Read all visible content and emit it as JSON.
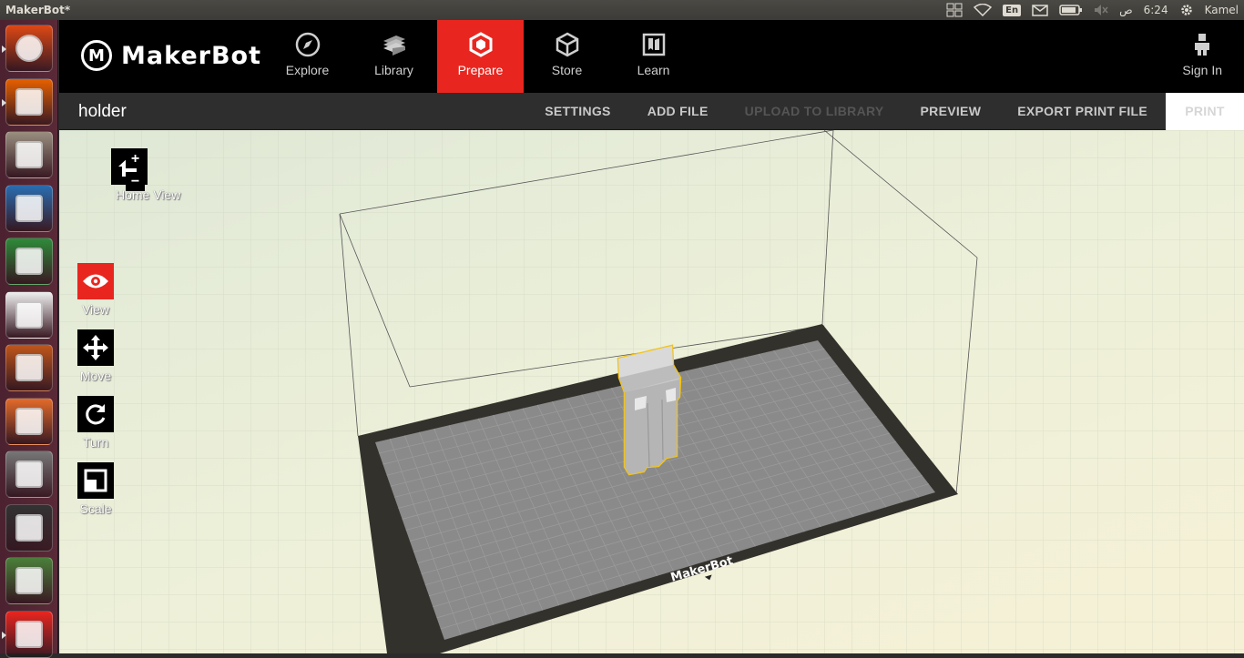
{
  "system": {
    "window_title": "MakerBot*",
    "keyboard_layout": "En",
    "time": "6:24",
    "am_pm": "ص",
    "user": "Kamel"
  },
  "launcher": [
    {
      "name": "ubuntu-dash-icon",
      "color": "#dd4814"
    },
    {
      "name": "firefox-icon",
      "color": "#e66000"
    },
    {
      "name": "files-icon",
      "color": "#9a8f80"
    },
    {
      "name": "writer-icon",
      "color": "#2a6db0"
    },
    {
      "name": "calc-icon",
      "color": "#2e8b3a"
    },
    {
      "name": "amazon-icon",
      "color": "#f0f0f0"
    },
    {
      "name": "impress-icon",
      "color": "#c0561a"
    },
    {
      "name": "software-center-icon",
      "color": "#e46b2a"
    },
    {
      "name": "system-settings-icon",
      "color": "#777777"
    },
    {
      "name": "terminal-icon",
      "color": "#333333"
    },
    {
      "name": "updater-icon",
      "color": "#4a7f3a"
    },
    {
      "name": "makerbot-icon",
      "color": "#e8261f"
    }
  ],
  "header": {
    "brand": "MakerBot",
    "nav": [
      {
        "label": "Explore",
        "icon": "compass-icon",
        "active": false
      },
      {
        "label": "Library",
        "icon": "library-icon",
        "active": false
      },
      {
        "label": "Prepare",
        "icon": "prepare-icon",
        "active": true
      },
      {
        "label": "Store",
        "icon": "store-icon",
        "active": false
      },
      {
        "label": "Learn",
        "icon": "learn-icon",
        "active": false
      }
    ],
    "sign_in": "Sign In"
  },
  "toolbar": {
    "file_name": "holder",
    "settings": "SETTINGS",
    "add_file": "ADD FILE",
    "upload": "UPLOAD TO LIBRARY",
    "preview": "PREVIEW",
    "export": "EXPORT PRINT FILE",
    "print": "PRINT"
  },
  "tools": {
    "home_view": "Home View",
    "zoom_in": "+",
    "zoom_out": "−",
    "view": "View",
    "move": "Move",
    "turn": "Turn",
    "scale": "Scale"
  },
  "scene": {
    "plate_logo": "MakerBot",
    "accent": "#e8261f",
    "selection_color": "#f3c316"
  }
}
